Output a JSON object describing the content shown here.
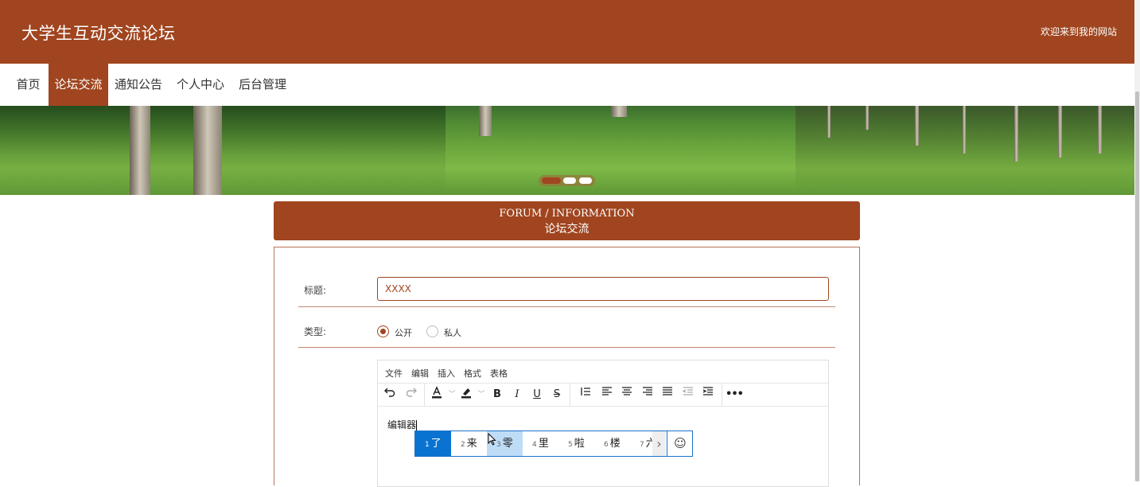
{
  "header": {
    "site_title": "大学生互动交流论坛",
    "welcome": "欢迎来到我的网站"
  },
  "nav": {
    "items": [
      "首页",
      "论坛交流",
      "通知公告",
      "个人中心",
      "后台管理"
    ],
    "active_index": 1
  },
  "banner": {
    "carousel_dots": 3,
    "active_dot": 0
  },
  "section": {
    "title_en": "FORUM / INFORMATION",
    "title_cn": "论坛交流"
  },
  "form": {
    "title_label": "标题:",
    "title_value": "XXXX",
    "type_label": "类型:",
    "type_options": [
      "公开",
      "私人"
    ],
    "type_selected": "公开"
  },
  "editor": {
    "menus": [
      "文件",
      "编辑",
      "插入",
      "格式",
      "表格"
    ],
    "content": "编辑器"
  },
  "ime": {
    "candidates": [
      {
        "num": "1",
        "text": "了"
      },
      {
        "num": "2",
        "text": "来"
      },
      {
        "num": "3",
        "text": "零"
      },
      {
        "num": "4",
        "text": "里"
      },
      {
        "num": "5",
        "text": "啦"
      },
      {
        "num": "6",
        "text": "楼"
      },
      {
        "num": "7",
        "text": "六"
      }
    ],
    "selected_index": 0,
    "hover_index": 2
  },
  "colors": {
    "brand": "#a0451f",
    "ime_accent": "#0a73d1"
  }
}
